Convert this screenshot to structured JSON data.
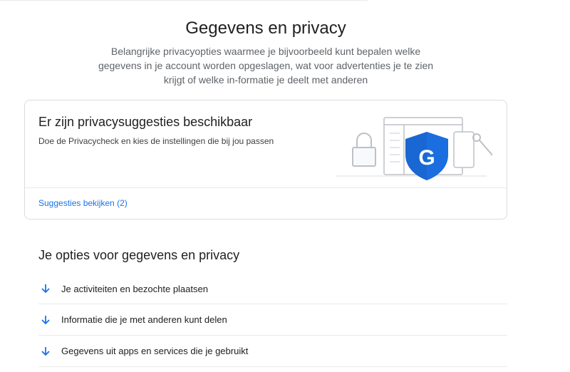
{
  "page": {
    "title": "Gegevens en privacy",
    "subtitle": "Belangrijke privacyopties waarmee je bijvoorbeeld kunt bepalen welke gegevens in je account worden opgeslagen, wat voor advertenties je te zien krijgt of welke in-formatie je deelt met anderen"
  },
  "suggestion_card": {
    "title": "Er zijn privacysuggesties beschikbaar",
    "description": "Doe de Privacycheck en kies de instellingen die bij jou passen",
    "link_label": "Suggesties bekijken (2)",
    "illustration_icon": "google-shield-icon",
    "shield_letter": "G"
  },
  "options_section": {
    "title": "Je opties voor gegevens en privacy",
    "items": [
      {
        "label": "Je activiteiten en bezochte plaatsen",
        "icon": "arrow-down-icon"
      },
      {
        "label": "Informatie die je met anderen kunt delen",
        "icon": "arrow-down-icon"
      },
      {
        "label": "Gegevens uit apps en services die je gebruikt",
        "icon": "arrow-down-icon"
      }
    ]
  },
  "colors": {
    "accent": "#1a73e8",
    "shield": "#1967d2",
    "text": "#202124",
    "muted": "#5f6368",
    "border": "#dadce0"
  }
}
